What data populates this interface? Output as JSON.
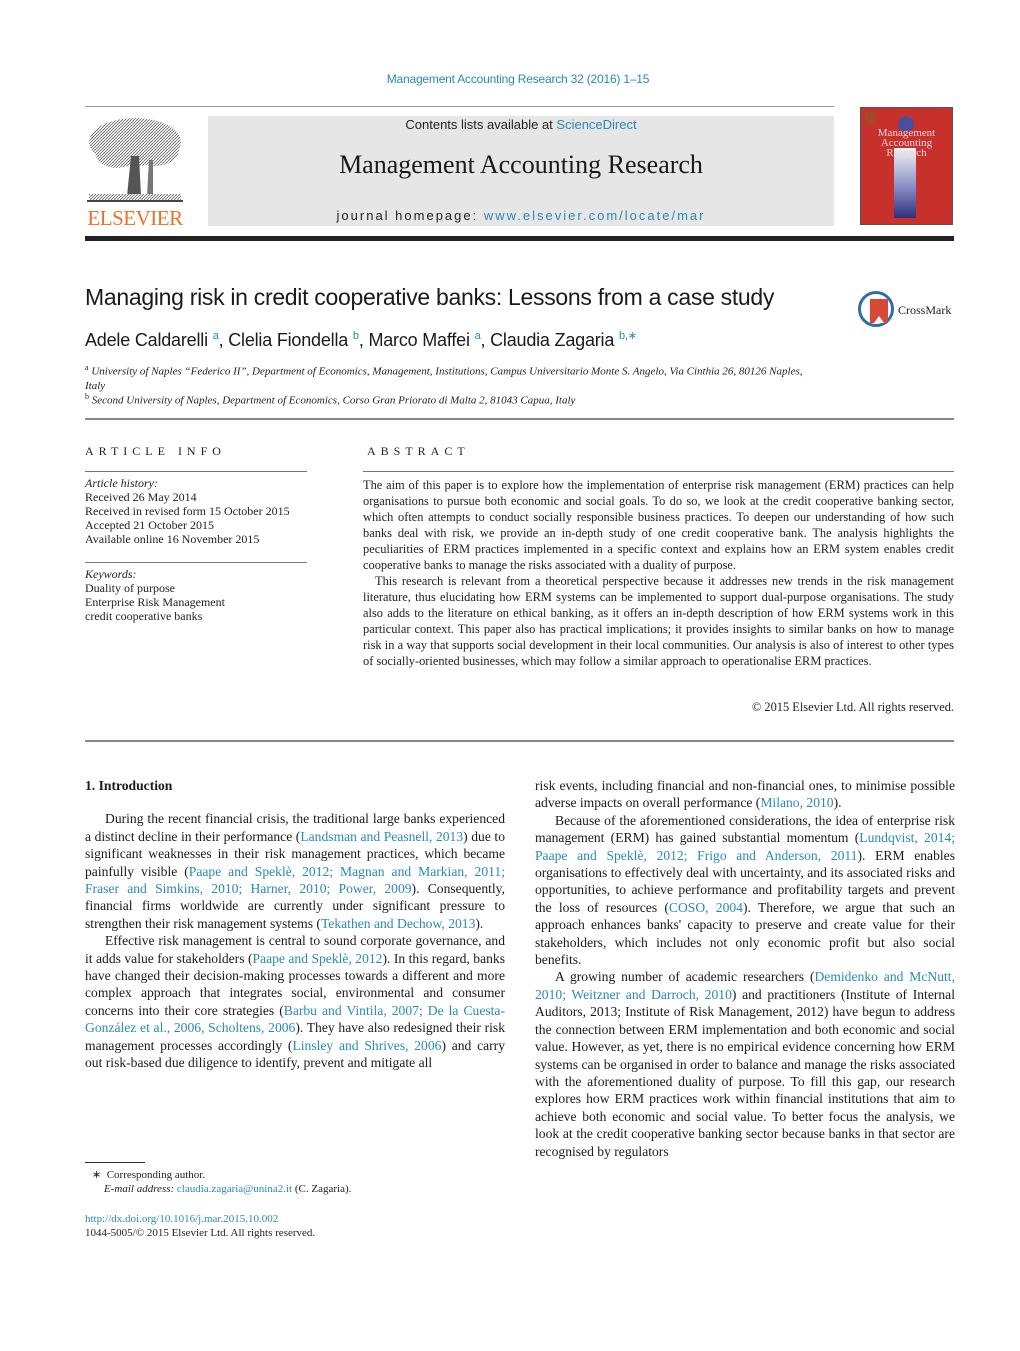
{
  "header": {
    "journal_ref": "Management Accounting Research 32 (2016) 1–15",
    "contents_prefix": "Contents lists available at ",
    "contents_link": "ScienceDirect",
    "journal_title": "Management Accounting Research",
    "homepage_prefix": "journal homepage: ",
    "homepage_link": "www.elsevier.com/locate/mar",
    "publisher": "ELSEVIER",
    "cover_title_lines": [
      "Management",
      "Accounting",
      "Research"
    ]
  },
  "article": {
    "title": "Managing risk in credit cooperative banks: Lessons from a case study",
    "crossmark_label": "CrossMark",
    "authors": [
      {
        "name": "Adele Caldarelli",
        "sup": "a"
      },
      {
        "name": "Clelia Fiondella",
        "sup": "b"
      },
      {
        "name": "Marco Maffei",
        "sup": "a"
      },
      {
        "name": "Claudia Zagaria",
        "sup": "b,∗"
      }
    ],
    "affiliations": [
      {
        "sup": "a",
        "text": "University of Naples “Federico II”, Department of Economics, Management, Institutions, Campus Universitario Monte S. Angelo, Via Cinthia 26, 80126 Naples, Italy"
      },
      {
        "sup": "b",
        "text": "Second University of Naples, Department of Economics, Corso Gran Priorato di Malta 2, 81043 Capua, Italy"
      }
    ]
  },
  "article_info": {
    "heading": "ARTICLE INFO",
    "history_label": "Article history:",
    "history": [
      "Received 26 May 2014",
      "Received in revised form 15 October 2015",
      "Accepted 21 October 2015",
      "Available online 16 November 2015"
    ],
    "keywords_label": "Keywords:",
    "keywords": [
      "Duality of purpose",
      "Enterprise Risk Management",
      "credit cooperative banks"
    ]
  },
  "abstract": {
    "heading": "ABSTRACT",
    "paragraphs": [
      "The aim of this paper is to explore how the implementation of enterprise risk management (ERM) practices can help organisations to pursue both economic and social goals. To do so, we look at the credit cooperative banking sector, which often attempts to conduct socially responsible business practices. To deepen our understanding of how such banks deal with risk, we provide an in-depth study of one credit cooperative bank. The analysis highlights the peculiarities of ERM practices implemented in a specific context and explains how an ERM system enables credit cooperative banks to manage the risks associated with a duality of purpose.",
      "This research is relevant from a theoretical perspective because it addresses new trends in the risk management literature, thus elucidating how ERM systems can be implemented to support dual-purpose organisations. The study also adds to the literature on ethical banking, as it offers an in-depth description of how ERM systems work in this particular context. This paper also has practical implications; it provides insights to similar banks on how to manage risk in a way that supports social development in their local communities. Our analysis is also of interest to other types of socially-oriented businesses, which may follow a similar approach to operationalise ERM practices."
    ],
    "copyright": "© 2015 Elsevier Ltd. All rights reserved."
  },
  "body": {
    "section_title": "1.  Introduction",
    "left_paragraphs": [
      [
        {
          "t": "During the recent financial crisis, the traditional large banks experienced a distinct decline in their performance ("
        },
        {
          "t": "Landsman and Peasnell, 2013",
          "link": true
        },
        {
          "t": ") due to significant weaknesses in their risk management practices, which became painfully visible ("
        },
        {
          "t": "Paape and Speklè, 2012; Magnan and Markian, 2011; Fraser and Simkins, 2010; Harner, 2010; Power, 2009",
          "link": true
        },
        {
          "t": "). Consequently, financial firms worldwide are currently under significant pressure to strengthen their risk management systems ("
        },
        {
          "t": "Tekathen and Dechow, 2013",
          "link": true
        },
        {
          "t": ")."
        }
      ],
      [
        {
          "t": "Effective risk management is central to sound corporate governance, and it adds value for stakeholders ("
        },
        {
          "t": "Paape and Speklè, 2012",
          "link": true
        },
        {
          "t": "). In this regard, banks have changed their decision-making processes towards a different and more complex approach that integrates social, environmental and consumer concerns into their core strategies ("
        },
        {
          "t": "Barbu and Vintila, 2007; De la Cuesta-González et al., 2006, Scholtens, 2006",
          "link": true
        },
        {
          "t": "). They have also redesigned their risk management processes accordingly ("
        },
        {
          "t": "Linsley and Shrives, 2006",
          "link": true
        },
        {
          "t": ") and carry out risk-based due diligence to identify, prevent and mitigate all"
        }
      ]
    ],
    "right_paragraphs": [
      [
        {
          "t": "risk events, including financial and non-financial ones, to minimise possible adverse impacts on overall performance ("
        },
        {
          "t": "Milano, 2010",
          "link": true
        },
        {
          "t": ")."
        }
      ],
      [
        {
          "t": "Because of the aforementioned considerations, the idea of enterprise risk management (ERM) has gained substantial momentum ("
        },
        {
          "t": "Lundqvist, 2014; Paape and Speklè, 2012; Frigo and Anderson, 2011",
          "link": true
        },
        {
          "t": "). ERM enables organisations to effectively deal with uncertainty, and its associated risks and opportunities, to achieve performance and profitability targets and prevent the loss of resources ("
        },
        {
          "t": "COSO, 2004",
          "link": true
        },
        {
          "t": "). Therefore, we argue that such an approach enhances banks' capacity to preserve and create value for their stakeholders, which includes not only economic profit but also social benefits."
        }
      ],
      [
        {
          "t": "A growing number of academic researchers ("
        },
        {
          "t": "Demidenko and McNutt, 2010; Weitzner and Darroch, 2010",
          "link": true
        },
        {
          "t": ") and practitioners (Institute of Internal Auditors, 2013; Institute of Risk Management, 2012) have begun to address the connection between ERM implementation and both economic and social value. However, as yet, there is no empirical evidence concerning how ERM systems can be organised in order to balance and manage the risks associated with the aforementioned duality of purpose. To fill this gap, our research explores how ERM practices work within financial institutions that aim to achieve both economic and social value. To better focus the analysis, we look at the credit cooperative banking sector because banks in that sector are recognised by regulators"
        }
      ]
    ]
  },
  "footnotes": {
    "marker": "∗",
    "corresponding": "Corresponding author.",
    "email_label": "E-mail address: ",
    "email": "claudia.zagaria@unina2.it",
    "email_suffix": " (C. Zagaria).",
    "doi": "http://dx.doi.org/10.1016/j.mar.2015.10.002",
    "issn_line": "1044-5005/© 2015 Elsevier Ltd. All rights reserved."
  }
}
